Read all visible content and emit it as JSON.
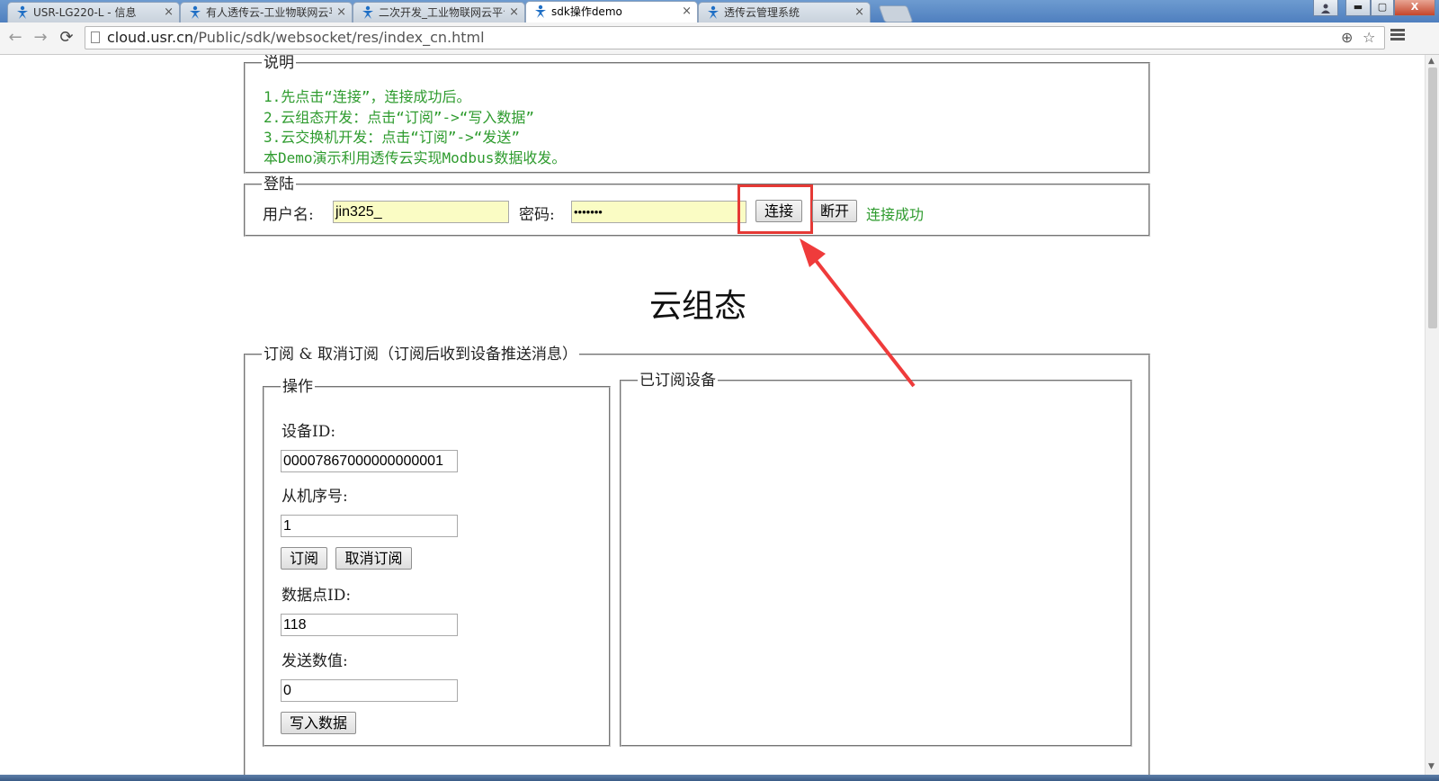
{
  "browser": {
    "tabs": [
      {
        "label": "USR-LG220-L - 信息",
        "active": false
      },
      {
        "label": "有人透传云-工业物联网云平台",
        "active": false
      },
      {
        "label": "二次开发_工业物联网云平台",
        "active": false
      },
      {
        "label": "sdk操作demo",
        "active": true
      },
      {
        "label": "透传云管理系统",
        "active": false
      }
    ],
    "tab_close": "×",
    "url_host": "cloud.usr.cn",
    "url_path": "/Public/sdk/websocket/res/index_cn.html",
    "nav": {
      "back": "←",
      "forward": "→",
      "reload": "⟳"
    },
    "zoom_glyph": "⊕",
    "star_glyph": "☆",
    "window_controls": {
      "minimize": "▬",
      "maximize": "▢",
      "close": "X"
    }
  },
  "instructions": {
    "legend": "说明",
    "lines": [
      "1.先点击“连接”，连接成功后。",
      "2.云组态开发：点击“订阅”->“写入数据”",
      "3.云交换机开发：点击“订阅”->“发送”",
      "本Demo演示利用透传云实现Modbus数据收发。"
    ]
  },
  "login": {
    "legend": "登陆",
    "username_label": "用户名:",
    "username_value": "jin325_",
    "password_label": "密码:",
    "password_value": "•••••••",
    "connect_button": "连接",
    "disconnect_button": "断开",
    "status_text": "连接成功"
  },
  "section_title": "云组态",
  "subscribe": {
    "legend": "订阅 & 取消订阅（订阅后收到设备推送消息）",
    "operation": {
      "legend": "操作",
      "device_id_label": "设备ID:",
      "device_id_value": "00007867000000000001",
      "slave_label": "从机序号:",
      "slave_value": "1",
      "subscribe_button": "订阅",
      "unsubscribe_button": "取消订阅",
      "datapoint_label": "数据点ID:",
      "datapoint_value": "118",
      "send_value_label": "发送数值:",
      "send_value": "0",
      "write_button": "写入数据"
    },
    "subscribed_devices": {
      "legend": "已订阅设备"
    }
  },
  "colors": {
    "instruction_text": "#2e9b2e",
    "status_text": "#2e9b2e",
    "highlight": "#e53935",
    "input_yellow": "#fafcc4"
  },
  "scrollbar": {
    "up": "▲",
    "down": "▼"
  }
}
